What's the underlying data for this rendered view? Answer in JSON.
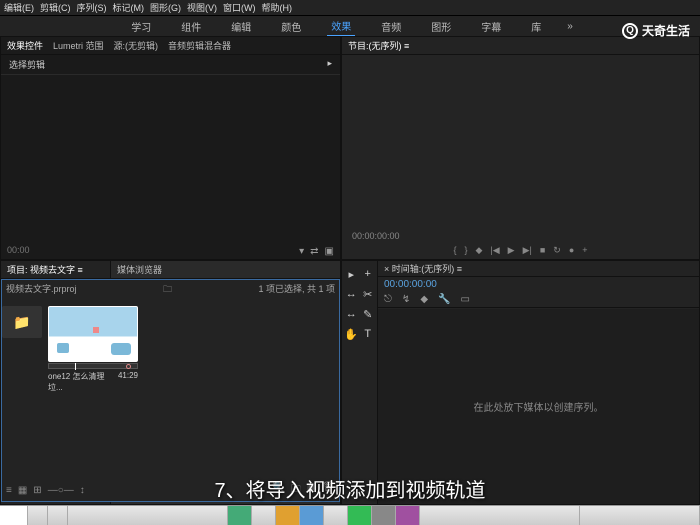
{
  "menu": {
    "items": [
      "编辑(E)",
      "剪辑(C)",
      "序列(S)",
      "标记(M)",
      "图形(G)",
      "视图(V)",
      "窗口(W)",
      "帮助(H)"
    ]
  },
  "workspaces": {
    "items": [
      "学习",
      "组件",
      "编辑",
      "颜色",
      "效果",
      "音频",
      "图形",
      "字幕",
      "库"
    ],
    "active": 4,
    "overflow": "»"
  },
  "watermark": {
    "text": "天奇生活",
    "icon": "Q"
  },
  "source_panel": {
    "tabs": [
      "效果控件",
      "Lumetri 范围",
      "源:(无剪辑)",
      "音频剪辑混合器"
    ],
    "active": 0,
    "effects_row": "选择剪辑",
    "effects_arrow": "▸",
    "tc": "00:00"
  },
  "program_panel": {
    "tab_label": "节目:(无序列) ≡",
    "tc": "00:00:00:00"
  },
  "project_panel": {
    "left_tabs": [
      "项目: 视频去文字 ≡",
      "媒体浏览器"
    ],
    "project_name": "视频去文字.prproj",
    "selection_info": "1 项已选择, 共 1 项",
    "clip_name": "one12 怎么清理垃...",
    "clip_dur": "41:29"
  },
  "timeline_panel": {
    "tab_label": "× 时间轴:(无序列) ≡",
    "tc": "00:00:00:00",
    "empty_msg": "在此处放下媒体以创建序列。"
  },
  "caption": "7、将导入视频添加到视频轨道",
  "icons": {
    "folder": "🗀",
    "funnel": "▾",
    "arrows": "⇄",
    "newbin": "▣",
    "cursor": "▸",
    "plus": "+",
    "razor": "✂",
    "slip": "↔",
    "hand": "✋",
    "pen": "✎",
    "type": "T",
    "rect": "▭",
    "snap": "⎋",
    "link": "↯",
    "marker": "◆",
    "wrench": "🔧",
    "step_b": "|◀",
    "play": "▶",
    "step_f": "▶|",
    "loop": "↻",
    "stop": "■",
    "rec": "●",
    "in": "{",
    "out": "}",
    "list": "≡",
    "grid": "▦",
    "freeform": "⊞",
    "sort": "↕",
    "zoom": "—○—",
    "search": "🔍",
    "trash": "🗑",
    "folder2": "📁"
  }
}
